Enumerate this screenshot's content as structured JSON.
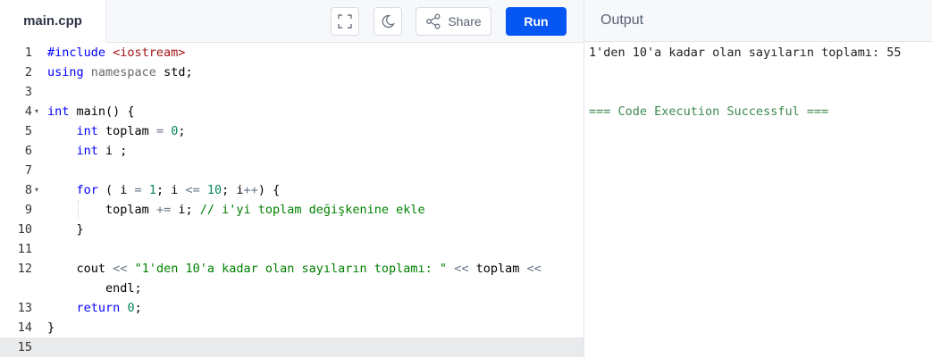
{
  "editor": {
    "file_name": "main.cpp",
    "fullscreen_icon": "fullscreen-icon",
    "theme_icon": "moon-icon",
    "share_icon": "share-icon",
    "share_label": "Share",
    "run_label": "Run"
  },
  "output": {
    "header": "Output",
    "lines": [
      "1'den 10'a kadar olan sayıların toplamı: 55",
      "=== Code Execution Successful ==="
    ]
  },
  "code": {
    "line_numbers": [
      "1",
      "2",
      "3",
      "4",
      "5",
      "6",
      "7",
      "8",
      "9",
      "10",
      "11",
      "12",
      "",
      "13",
      "14",
      "15"
    ],
    "l1_a": "#include ",
    "l1_b": "<iostream>",
    "l2_a": "using",
    "l2_b": "namespace",
    "l2_c": "std;",
    "l4_a": "int",
    "l4_b": " main() {",
    "l5_a": "int",
    "l5_b": " toplam ",
    "l5_c": "=",
    "l5_d": "0",
    "l5_e": ";",
    "l6_a": "int",
    "l6_b": " i ;",
    "l8_a": "for",
    "l8_b": " ( i ",
    "l8_c": "=",
    "l8_d": "1",
    "l8_e": "; i ",
    "l8_f": "<=",
    "l8_g": "10",
    "l8_h": "; i",
    "l8_i": "++",
    "l8_j": ") {",
    "l9_a": "toplam ",
    "l9_b": "+=",
    "l9_c": " i; ",
    "l9_d": "// i'yi toplam değişkenine ekle",
    "l10": "}",
    "l12_a": "cout ",
    "l12_b": "<<",
    "l12_c": "\"1'den 10'a kadar olan sayıların toplamı: \"",
    "l12_d": "<<",
    "l12_e": " toplam ",
    "l12_f": "<<",
    "l12w": "endl;",
    "l13_a": "return",
    "l13_b": "0",
    "l13_c": ";",
    "l14": "}"
  }
}
